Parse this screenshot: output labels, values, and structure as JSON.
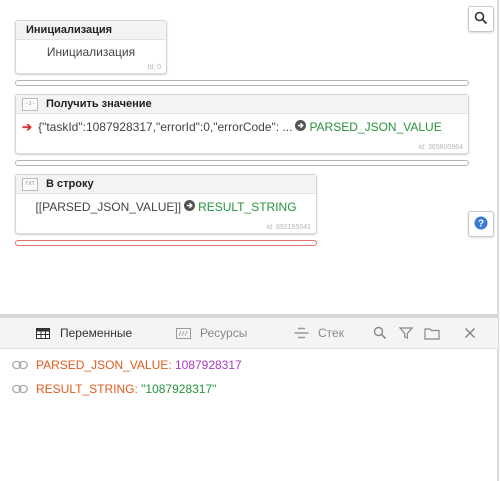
{
  "blocks": [
    {
      "title": "Инициализация",
      "body": "Инициализация",
      "id": "Id: 0"
    },
    {
      "title": "Получить значение",
      "icon_text": "- J -",
      "expr": "{\"taskId\":1087928317,\"errorId\":0,\"errorCode\": ...",
      "target": "PARSED_JSON_VALUE",
      "id": "Id: 365800964"
    },
    {
      "title": "В строку",
      "icon_text": "TXT",
      "expr": "[[PARSED_JSON_VALUE]]",
      "target": "RESULT_STRING",
      "id": "Id: 892155041"
    }
  ],
  "panel": {
    "tabs": [
      {
        "label": "Переменные",
        "icon": "table-icon",
        "active": true
      },
      {
        "label": "Ресурсы",
        "icon": "resources-icon",
        "active": false
      },
      {
        "label": "Стек",
        "icon": "stack-icon",
        "active": false
      }
    ],
    "tools": [
      "search-icon",
      "filter-icon",
      "folder-icon",
      "close-icon"
    ]
  },
  "variables": [
    {
      "name": "PARSED_JSON_VALUE",
      "sep": ": ",
      "value": "1087928317",
      "kind": "number"
    },
    {
      "name": "RESULT_STRING",
      "sep": ": ",
      "value": "\"1087928317\"",
      "kind": "string"
    }
  ],
  "colors": {
    "accent_green": "#26923b",
    "var_name": "#e05a1c",
    "number_value": "#a93ac4",
    "string_value": "#26923b",
    "error_line": "#e86d6d"
  }
}
